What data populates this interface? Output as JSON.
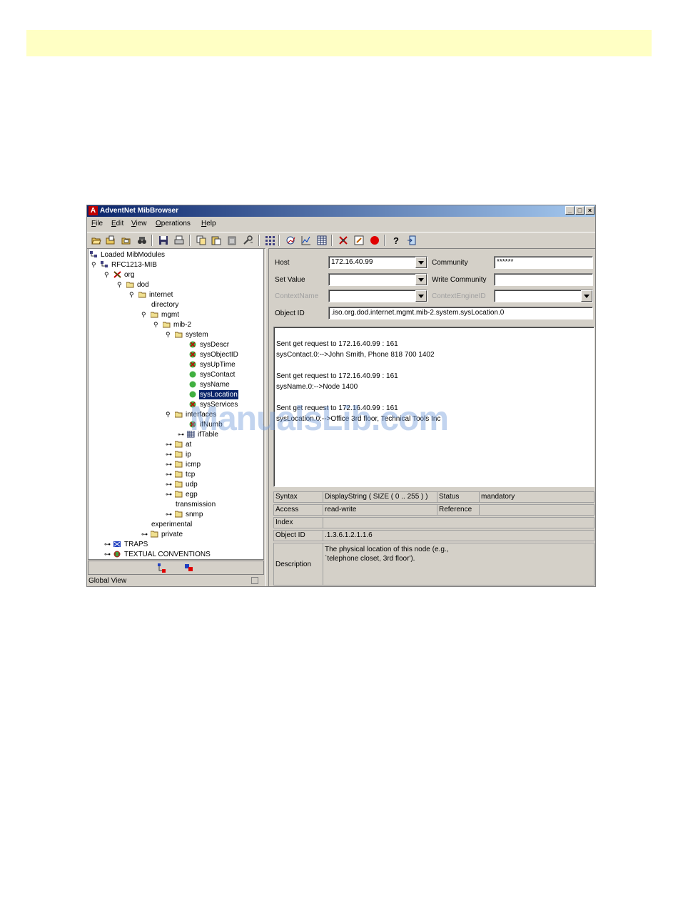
{
  "window": {
    "title": "AdventNet MibBrowser",
    "app_icon": "A",
    "controls": [
      "_",
      "□",
      "×"
    ]
  },
  "menu": [
    {
      "key": "F",
      "rest": "ile"
    },
    {
      "key": "E",
      "rest": "dit"
    },
    {
      "key": "V",
      "rest": "iew"
    },
    {
      "key": "O",
      "rest": "perations"
    },
    {
      "key": "H",
      "rest": "elp"
    }
  ],
  "toolbar_icons": [
    "open-folder-icon",
    "open-file-icon",
    "load-mib-icon",
    "find-icon",
    "save-icon",
    "print-icon",
    "copy-icon",
    "paste-icon",
    "clipboard-icon",
    "settings-icon",
    "tree-icon",
    "graph-icon",
    "line-chart-icon",
    "table-icon",
    "trap-icon",
    "edit-icon",
    "stop-icon",
    "help-icon",
    "exit-icon"
  ],
  "tree": {
    "root": "Loaded MibModules",
    "module": "RFC1213-MIB",
    "org": "org",
    "dod": "dod",
    "internet": "internet",
    "directory": "directory",
    "mgmt": "mgmt",
    "mib2": "mib-2",
    "system": "system",
    "sysDescr": "sysDescr",
    "sysObjectID": "sysObjectID",
    "sysUpTime": "sysUpTime",
    "sysContact": "sysContact",
    "sysName": "sysName",
    "sysLocation": "sysLocation",
    "sysServices": "sysServices",
    "interfaces": "interfaces",
    "ifNumber": "ifNumb",
    "ifTable": "ifTable",
    "at": "at",
    "ip": "ip",
    "icmp": "icmp",
    "tcp": "tcp",
    "udp": "udp",
    "egp": "egp",
    "transmission": "transmission",
    "snmp": "snmp",
    "experimental": "experimental",
    "private": "private",
    "traps": "TRAPS",
    "textual": "TEXTUAL CONVENTIONS"
  },
  "status_bar": "Global View",
  "form": {
    "host_label": "Host",
    "host_value": "172.16.40.99",
    "community_label": "Community",
    "community_value": "******",
    "set_value_label": "Set Value",
    "set_value": "",
    "write_community_label": "Write Community",
    "write_community_value": "",
    "context_name_label": "ContextName",
    "context_name_value": "",
    "context_engine_label": "ContextEngineID",
    "context_engine_value": "",
    "object_id_label": "Object ID",
    "object_id_value": ".iso.org.dod.internet.mgmt.mib-2.system.sysLocation.0"
  },
  "output_lines": [
    "Sent get request to 172.16.40.99 : 161",
    "sysContact.0:-->John Smith, Phone 818 700 1402",
    "Sent get request to 172.16.40.99 : 161",
    "sysName.0:-->Node 1400",
    "Sent get request to 172.16.40.99 : 161",
    "sysLocation.0:-->Office 3rd floor, Technical Tools Inc"
  ],
  "properties": {
    "syntax_label": "Syntax",
    "syntax_value": "DisplayString  ( SIZE ( 0 .. 255 ) )",
    "status_label": "Status",
    "status_value": "mandatory",
    "access_label": "Access",
    "access_value": "read-write",
    "reference_label": "Reference",
    "reference_value": "",
    "index_label": "Index",
    "index_value": "",
    "oid_label": "Object ID",
    "oid_value": ".1.3.6.1.2.1.1.6",
    "description_label": "Description",
    "description_line1": "The physical location of this node (e.g.,",
    "description_line2": "`telephone closet, 3rd floor')."
  },
  "watermark": "ManualsLib.com"
}
